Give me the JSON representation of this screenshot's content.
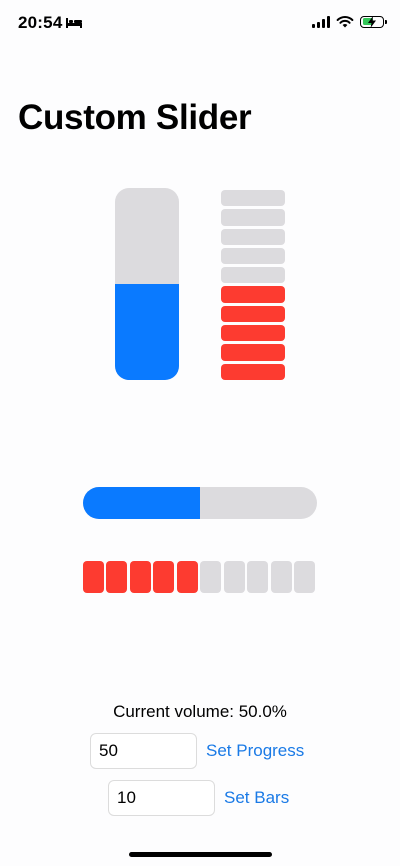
{
  "status_bar": {
    "time": "20:54",
    "sleep_icon": "bed-icon",
    "signal_icon": "cellular-signal-icon",
    "wifi_icon": "wifi-icon",
    "battery_icon": "battery-charging-icon",
    "battery_level": 0.6
  },
  "title": "Custom Slider",
  "vertical_slider": {
    "value": 0.5,
    "color": "#0a7aff",
    "track_color": "#dcdbde"
  },
  "vertical_bars": {
    "total": 10,
    "active": 5,
    "color": "#fd3b30",
    "inactive_color": "#dcdbde"
  },
  "horizontal_slider": {
    "value": 0.5,
    "color": "#0a7aff",
    "track_color": "#dcdbde"
  },
  "horizontal_bars": {
    "total": 10,
    "active": 5,
    "color": "#fd3b30",
    "inactive_color": "#dcdbde"
  },
  "volume_label": "Current volume: 50.0%",
  "progress_input": {
    "value": "50"
  },
  "set_progress_label": "Set Progress",
  "bars_input": {
    "value": "10"
  },
  "set_bars_label": "Set Bars"
}
